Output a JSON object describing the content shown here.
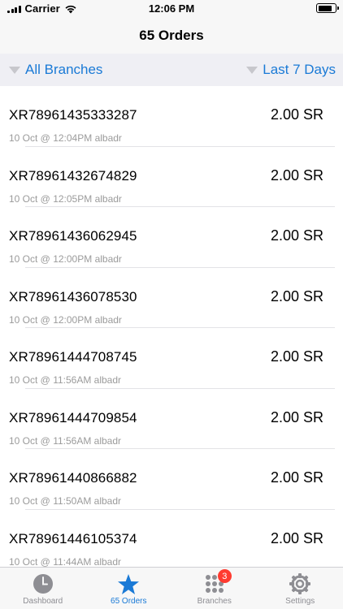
{
  "status_bar": {
    "carrier": "Carrier",
    "time": "12:06 PM",
    "battery_level": 0.75
  },
  "nav": {
    "title": "65 Orders"
  },
  "filters": {
    "branch_label": "All Branches",
    "period_label": "Last 7 Days"
  },
  "orders": [
    {
      "id": "XR78961435333287",
      "amount": "2.00 SR",
      "meta": "10 Oct @ 12:04PM albadr"
    },
    {
      "id": "XR78961432674829",
      "amount": "2.00 SR",
      "meta": "10 Oct @ 12:05PM albadr"
    },
    {
      "id": "XR78961436062945",
      "amount": "2.00 SR",
      "meta": "10 Oct @ 12:00PM albadr"
    },
    {
      "id": "XR78961436078530",
      "amount": "2.00 SR",
      "meta": "10 Oct @ 12:00PM albadr"
    },
    {
      "id": "XR78961444708745",
      "amount": "2.00 SR",
      "meta": "10 Oct @ 11:56AM albadr"
    },
    {
      "id": "XR78961444709854",
      "amount": "2.00 SR",
      "meta": "10 Oct @ 11:56AM albadr"
    },
    {
      "id": "XR78961440866882",
      "amount": "2.00 SR",
      "meta": "10 Oct @ 11:50AM albadr"
    },
    {
      "id": "XR78961446105374",
      "amount": "2.00 SR",
      "meta": "10 Oct @ 11:44AM albadr"
    }
  ],
  "tabs": [
    {
      "label": "Dashboard",
      "icon": "clock-icon",
      "active": false
    },
    {
      "label": "65 Orders",
      "icon": "star-icon",
      "active": true
    },
    {
      "label": "Branches",
      "icon": "grid-dots-icon",
      "active": false,
      "badge": "3"
    },
    {
      "label": "Settings",
      "icon": "gear-icon",
      "active": false
    }
  ],
  "colors": {
    "accent": "#1a7ad6",
    "inactive": "#8e8e93",
    "badge": "#ff3b30"
  }
}
